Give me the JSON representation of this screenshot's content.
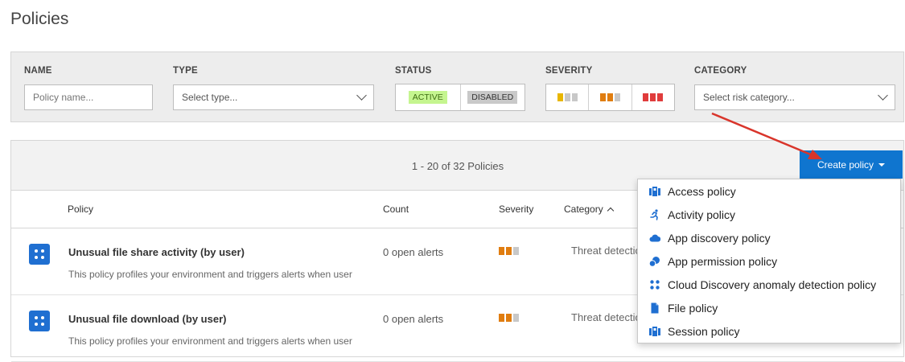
{
  "page": {
    "title": "Policies"
  },
  "filters": {
    "name": {
      "label": "NAME",
      "placeholder": "Policy name..."
    },
    "type": {
      "label": "TYPE",
      "value": "Select type..."
    },
    "status": {
      "label": "STATUS",
      "active": "ACTIVE",
      "disabled": "DISABLED"
    },
    "severity": {
      "label": "SEVERITY",
      "levels": [
        "low",
        "medium",
        "high"
      ]
    },
    "category": {
      "label": "CATEGORY",
      "value": "Select risk category..."
    }
  },
  "toolbar": {
    "count_text": "1 - 20 of 32 Policies",
    "create_label": "Create policy",
    "accent": "#0f75cf"
  },
  "table": {
    "headers": {
      "policy": "Policy",
      "count": "Count",
      "severity": "Severity",
      "category": "Category"
    },
    "rows": [
      {
        "name": "Unusual file share activity (by user)",
        "description": "This policy profiles your environment and triggers alerts when user",
        "count": "0 open alerts",
        "severity": "medium",
        "category": "Threat detection"
      },
      {
        "name": "Unusual file download (by user)",
        "description": "This policy profiles your environment and triggers alerts when user",
        "count": "0 open alerts",
        "severity": "medium",
        "category": "Threat detection"
      }
    ]
  },
  "dropdown": {
    "items": [
      {
        "label": "Access policy",
        "icon": "access-policy-icon"
      },
      {
        "label": "Activity policy",
        "icon": "running-person-icon"
      },
      {
        "label": "App discovery policy",
        "icon": "cloud-icon"
      },
      {
        "label": "App permission policy",
        "icon": "app-permission-icon"
      },
      {
        "label": "Cloud Discovery anomaly detection policy",
        "icon": "anomaly-dots-icon"
      },
      {
        "label": "File policy",
        "icon": "file-icon"
      },
      {
        "label": "Session policy",
        "icon": "session-policy-icon"
      }
    ]
  },
  "colors": {
    "sev_low": "#e8b600",
    "sev_medium": "#e07d10",
    "sev_high": "#e03c3c",
    "sev_off": "#c8c8c8",
    "icon_blue": "#1f6fd1",
    "arrow_red": "#d9352b"
  }
}
